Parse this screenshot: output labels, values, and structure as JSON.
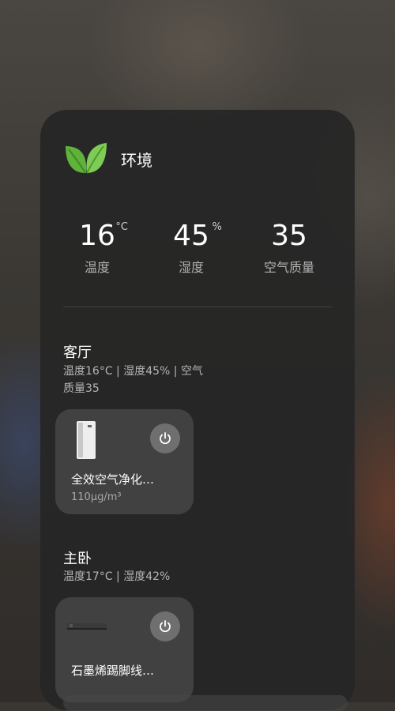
{
  "environment": {
    "title": "环境",
    "stats": [
      {
        "value": "16",
        "unit": "°C",
        "label": "温度"
      },
      {
        "value": "45",
        "unit": "%",
        "label": "湿度"
      },
      {
        "value": "35",
        "unit": "",
        "label": "空气质量"
      }
    ]
  },
  "rooms": [
    {
      "name": "客厅",
      "summary": "温度16°C | 湿度45% | 空气质量35",
      "device": {
        "name": "全效空气净化…",
        "reading": "110μg/m³",
        "icon": "air-purifier-icon"
      }
    },
    {
      "name": "主卧",
      "summary": "温度17°C | 湿度42%",
      "device": {
        "name": "石墨烯踢脚线…",
        "reading": "",
        "icon": "baseboard-heater-icon"
      }
    }
  ],
  "colors": {
    "leaf_green": "#6fbf4a",
    "panel_bg": "#262626",
    "card_bg": "#525252"
  }
}
